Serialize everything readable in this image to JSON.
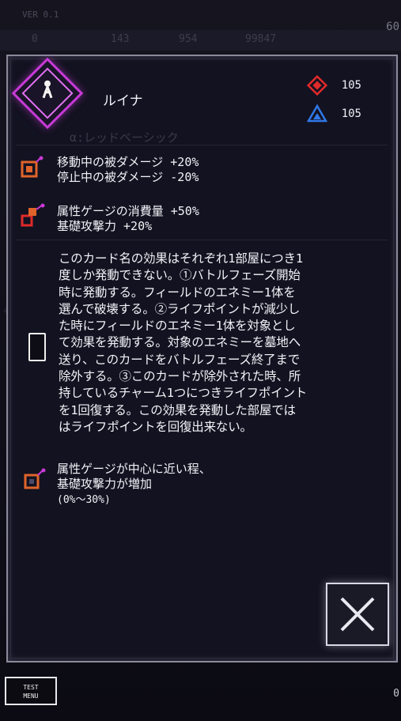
{
  "hud": {
    "version": "VER 0.1",
    "fps": "60",
    "resources": [
      "0",
      "143",
      "954",
      "99847"
    ]
  },
  "dialog": {
    "character_name": "ルイナ",
    "stats": [
      {
        "icon": "red-diamond-icon",
        "value": "105",
        "color": "#e02a2a"
      },
      {
        "icon": "blue-triangle-icon",
        "value": "105",
        "color": "#2f78e8"
      }
    ],
    "subtitle": "α:レッドベーシック",
    "effect1": {
      "line1": "移動中の被ダメージ +20%",
      "line2": "停止中の被ダメージ -20%"
    },
    "effect2": {
      "line1": "属性ゲージの消費量 +50%",
      "line2": "基礎攻撃力 +20%"
    },
    "card_description": [
      "このカード名の効果はそれぞれ1部屋につき1",
      "度しか発動できない。①バトルフェーズ開始",
      "時に発動する。フィールドのエネミー1体を",
      "選んで破壊する。②ライフポイントが減少し",
      "た時にフィールドのエネミー1体を対象とし",
      "て効果を発動する。対象のエネミーを墓地へ",
      "送り、このカードをバトルフェーズ終了まで",
      "除外する。③このカードが除外された時、所",
      "持しているチャーム1つにつきライフポイント",
      "を1回復する。この効果を発動した部屋では",
      "はライフポイントを回復出来ない。"
    ],
    "effect3": {
      "line1": "属性ゲージが中心に近い程、",
      "line2": "基礎攻撃力が増加",
      "line3": "(0%～30%)"
    }
  },
  "buttons": {
    "close_icon": "close-x-icon",
    "test_menu": "TEST\nMENU"
  },
  "bottom_counter": "0",
  "colors": {
    "accent_magenta": "#c93ad8",
    "frame": "#8b8a9b",
    "background": "#131220"
  }
}
